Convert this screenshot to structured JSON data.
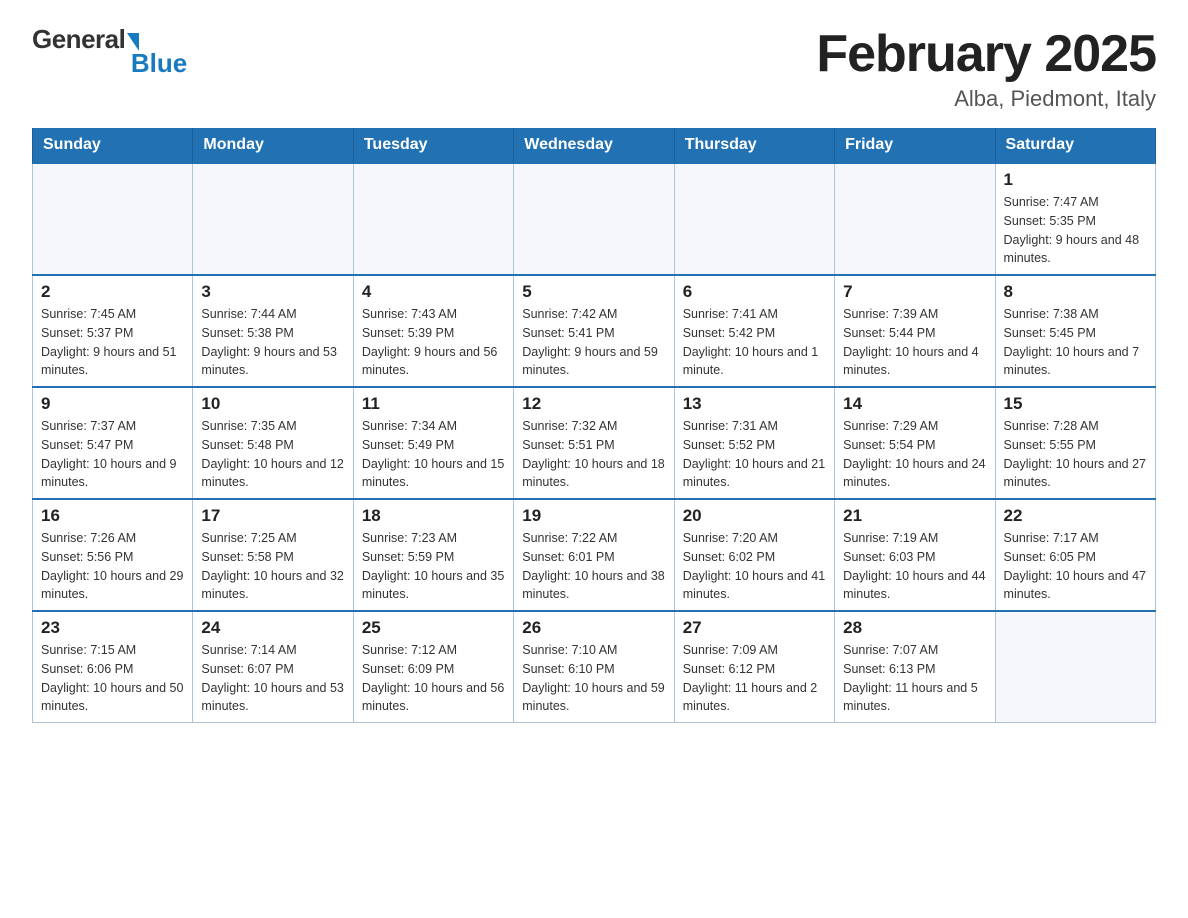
{
  "logo": {
    "general": "General",
    "blue": "Blue"
  },
  "title": "February 2025",
  "subtitle": "Alba, Piedmont, Italy",
  "days_of_week": [
    "Sunday",
    "Monday",
    "Tuesday",
    "Wednesday",
    "Thursday",
    "Friday",
    "Saturday"
  ],
  "weeks": [
    [
      {
        "day": "",
        "info": ""
      },
      {
        "day": "",
        "info": ""
      },
      {
        "day": "",
        "info": ""
      },
      {
        "day": "",
        "info": ""
      },
      {
        "day": "",
        "info": ""
      },
      {
        "day": "",
        "info": ""
      },
      {
        "day": "1",
        "info": "Sunrise: 7:47 AM\nSunset: 5:35 PM\nDaylight: 9 hours and 48 minutes."
      }
    ],
    [
      {
        "day": "2",
        "info": "Sunrise: 7:45 AM\nSunset: 5:37 PM\nDaylight: 9 hours and 51 minutes."
      },
      {
        "day": "3",
        "info": "Sunrise: 7:44 AM\nSunset: 5:38 PM\nDaylight: 9 hours and 53 minutes."
      },
      {
        "day": "4",
        "info": "Sunrise: 7:43 AM\nSunset: 5:39 PM\nDaylight: 9 hours and 56 minutes."
      },
      {
        "day": "5",
        "info": "Sunrise: 7:42 AM\nSunset: 5:41 PM\nDaylight: 9 hours and 59 minutes."
      },
      {
        "day": "6",
        "info": "Sunrise: 7:41 AM\nSunset: 5:42 PM\nDaylight: 10 hours and 1 minute."
      },
      {
        "day": "7",
        "info": "Sunrise: 7:39 AM\nSunset: 5:44 PM\nDaylight: 10 hours and 4 minutes."
      },
      {
        "day": "8",
        "info": "Sunrise: 7:38 AM\nSunset: 5:45 PM\nDaylight: 10 hours and 7 minutes."
      }
    ],
    [
      {
        "day": "9",
        "info": "Sunrise: 7:37 AM\nSunset: 5:47 PM\nDaylight: 10 hours and 9 minutes."
      },
      {
        "day": "10",
        "info": "Sunrise: 7:35 AM\nSunset: 5:48 PM\nDaylight: 10 hours and 12 minutes."
      },
      {
        "day": "11",
        "info": "Sunrise: 7:34 AM\nSunset: 5:49 PM\nDaylight: 10 hours and 15 minutes."
      },
      {
        "day": "12",
        "info": "Sunrise: 7:32 AM\nSunset: 5:51 PM\nDaylight: 10 hours and 18 minutes."
      },
      {
        "day": "13",
        "info": "Sunrise: 7:31 AM\nSunset: 5:52 PM\nDaylight: 10 hours and 21 minutes."
      },
      {
        "day": "14",
        "info": "Sunrise: 7:29 AM\nSunset: 5:54 PM\nDaylight: 10 hours and 24 minutes."
      },
      {
        "day": "15",
        "info": "Sunrise: 7:28 AM\nSunset: 5:55 PM\nDaylight: 10 hours and 27 minutes."
      }
    ],
    [
      {
        "day": "16",
        "info": "Sunrise: 7:26 AM\nSunset: 5:56 PM\nDaylight: 10 hours and 29 minutes."
      },
      {
        "day": "17",
        "info": "Sunrise: 7:25 AM\nSunset: 5:58 PM\nDaylight: 10 hours and 32 minutes."
      },
      {
        "day": "18",
        "info": "Sunrise: 7:23 AM\nSunset: 5:59 PM\nDaylight: 10 hours and 35 minutes."
      },
      {
        "day": "19",
        "info": "Sunrise: 7:22 AM\nSunset: 6:01 PM\nDaylight: 10 hours and 38 minutes."
      },
      {
        "day": "20",
        "info": "Sunrise: 7:20 AM\nSunset: 6:02 PM\nDaylight: 10 hours and 41 minutes."
      },
      {
        "day": "21",
        "info": "Sunrise: 7:19 AM\nSunset: 6:03 PM\nDaylight: 10 hours and 44 minutes."
      },
      {
        "day": "22",
        "info": "Sunrise: 7:17 AM\nSunset: 6:05 PM\nDaylight: 10 hours and 47 minutes."
      }
    ],
    [
      {
        "day": "23",
        "info": "Sunrise: 7:15 AM\nSunset: 6:06 PM\nDaylight: 10 hours and 50 minutes."
      },
      {
        "day": "24",
        "info": "Sunrise: 7:14 AM\nSunset: 6:07 PM\nDaylight: 10 hours and 53 minutes."
      },
      {
        "day": "25",
        "info": "Sunrise: 7:12 AM\nSunset: 6:09 PM\nDaylight: 10 hours and 56 minutes."
      },
      {
        "day": "26",
        "info": "Sunrise: 7:10 AM\nSunset: 6:10 PM\nDaylight: 10 hours and 59 minutes."
      },
      {
        "day": "27",
        "info": "Sunrise: 7:09 AM\nSunset: 6:12 PM\nDaylight: 11 hours and 2 minutes."
      },
      {
        "day": "28",
        "info": "Sunrise: 7:07 AM\nSunset: 6:13 PM\nDaylight: 11 hours and 5 minutes."
      },
      {
        "day": "",
        "info": ""
      }
    ]
  ]
}
